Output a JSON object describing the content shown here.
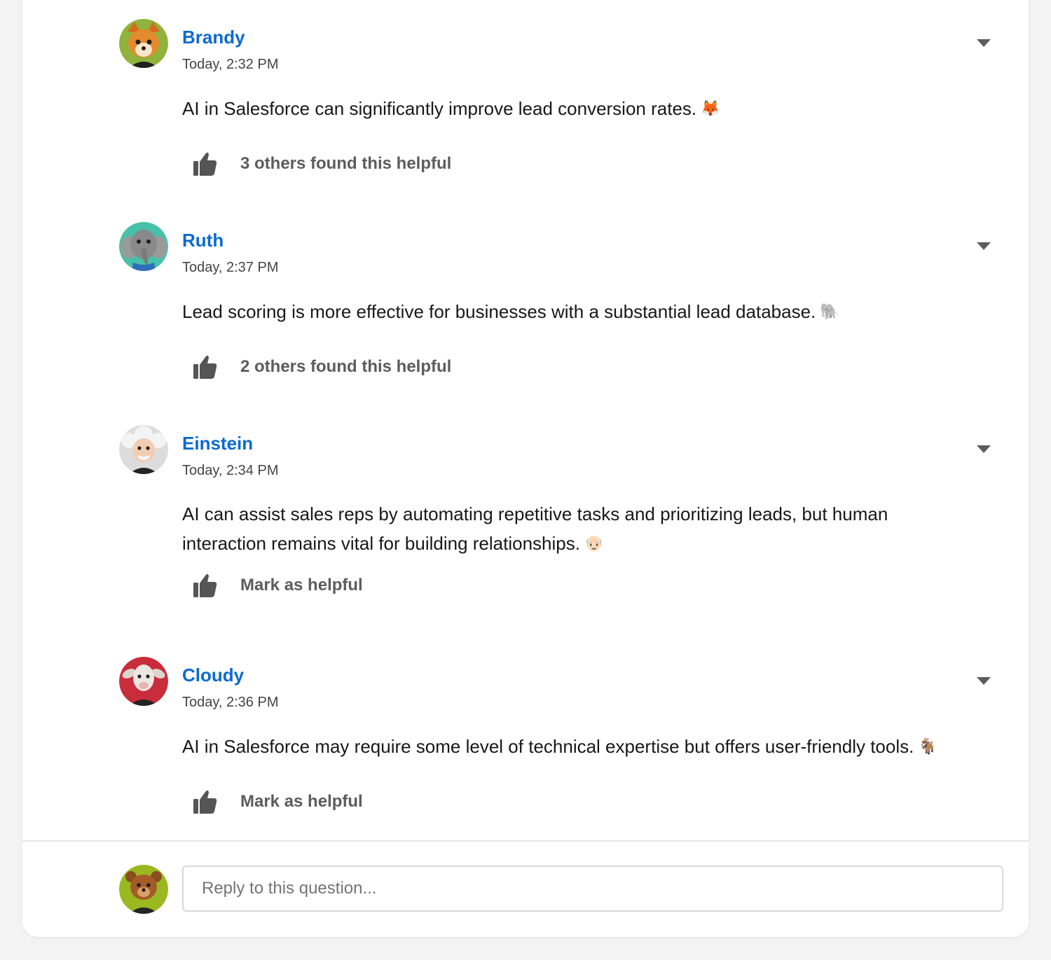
{
  "posts": [
    {
      "author": "Brandy",
      "timestamp": "Today, 2:32 PM",
      "body": "AI in Salesforce can significantly improve lead conversion rates.",
      "emoji": "🦊",
      "helpful": "3 others found this helpful",
      "avatar_icon": "fox-avatar",
      "avatar_color": "#e58a2c"
    },
    {
      "author": "Ruth",
      "timestamp": "Today, 2:37 PM",
      "body": "Lead scoring is more effective for businesses with a substantial lead database.",
      "emoji": "🐘",
      "helpful": "2 others found this helpful",
      "avatar_icon": "elephant-avatar",
      "avatar_color": "#8a8a8a"
    },
    {
      "author": "Einstein",
      "timestamp": "Today, 2:34 PM",
      "body": "AI can assist sales reps by automating repetitive tasks and prioritizing leads, but human interaction remains vital for building relationships.",
      "emoji": "👴🏻",
      "helpful": "Mark as helpful",
      "avatar_icon": "einstein-avatar",
      "avatar_color": "#e9e4dc"
    },
    {
      "author": "Cloudy",
      "timestamp": "Today, 2:36 PM",
      "body": "AI in Salesforce may require some level of technical expertise but offers user-friendly tools.",
      "emoji": "🐐",
      "helpful": "Mark as helpful",
      "avatar_icon": "goat-avatar",
      "avatar_color": "#c92d3b"
    }
  ],
  "reply": {
    "placeholder": "Reply to this question...",
    "avatar_icon": "bear-avatar",
    "avatar_color": "#9ab81f"
  },
  "colors": {
    "author_link": "#0b6ad0",
    "helpful_text": "#5c5c5c",
    "page_background": "#f3f3f3",
    "card_background": "#ffffff"
  }
}
